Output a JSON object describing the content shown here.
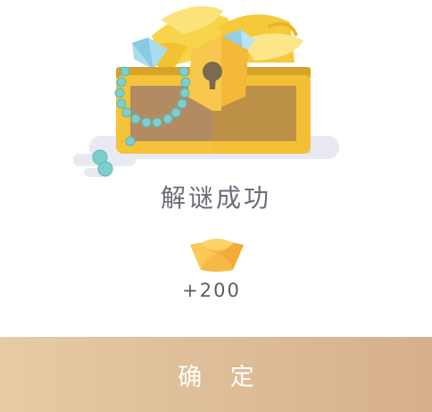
{
  "dialog": {
    "illustration": "treasure-chest-illustration",
    "title": "解谜成功",
    "reward": {
      "icon": "gold-ingot-icon",
      "amount": "+200"
    },
    "confirm_button": {
      "label": "确 定"
    }
  },
  "colors": {
    "title_text": "#6b6e79",
    "button_gradient_start": "#e6cba4",
    "button_gradient_end": "#d6b08b",
    "button_text": "#ffffff"
  }
}
